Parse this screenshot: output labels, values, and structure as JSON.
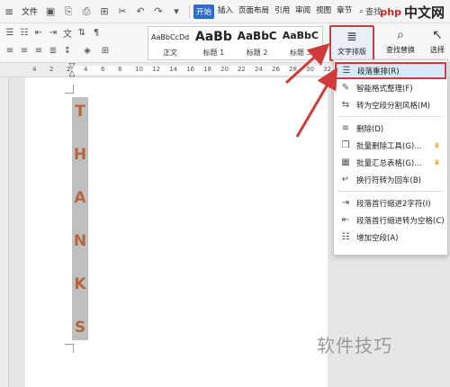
{
  "topbar": {
    "file_menu": "文件",
    "tabs": [
      "开始",
      "插入",
      "页面布局",
      "引用",
      "审阅",
      "视图",
      "章节"
    ],
    "active_tab_index": 0,
    "search_label": "查找",
    "brand_logo": "php",
    "brand_text": "中文网"
  },
  "ribbon": {
    "styles": [
      {
        "sample": "AaBbCcDd",
        "name": "正文"
      },
      {
        "sample": "AaBb",
        "name": "标题 1"
      },
      {
        "sample": "AaBbC",
        "name": "标题 2"
      },
      {
        "sample": "AaBbC",
        "name": "标题 3"
      }
    ],
    "text_layout_label": "文字排版",
    "find_replace_label": "查找替换",
    "select_label": "选择"
  },
  "ruler": {
    "numbers": [
      "4",
      "2",
      "2",
      "4",
      "6",
      "8",
      "10",
      "12",
      "14",
      "16",
      "18",
      "20",
      "22",
      "24",
      "26",
      "28",
      "30",
      "32"
    ]
  },
  "document": {
    "letters": [
      "T",
      "H",
      "A",
      "N",
      "K",
      "S"
    ],
    "letter_color": "#b5663c",
    "column_bg": "#bfbfbf"
  },
  "dropdown": {
    "items": [
      {
        "label": "段落重排(R)",
        "icon": "paragraph-rearrange-icon",
        "glyph": "☰",
        "highlighted": true,
        "premium": false
      },
      {
        "label": "智能格式整理(F)",
        "icon": "smart-format-icon",
        "glyph": "✎",
        "highlighted": false,
        "premium": false
      },
      {
        "label": "转为空段分割风格(M)",
        "icon": "split-style-icon",
        "glyph": "⇆",
        "highlighted": false,
        "premium": false
      },
      {
        "label": "删除(D)",
        "icon": "delete-icon",
        "glyph": "≡",
        "highlighted": false,
        "premium": false,
        "divider_before": true
      },
      {
        "label": "批量删除工具(G)...",
        "icon": "batch-delete-icon",
        "glyph": "❐",
        "highlighted": false,
        "premium": true
      },
      {
        "label": "批量汇总表格(G)...",
        "icon": "batch-table-icon",
        "glyph": "▦",
        "highlighted": false,
        "premium": true
      },
      {
        "label": "换行符转为回车(B)",
        "icon": "linebreak-icon",
        "glyph": "↵",
        "highlighted": false,
        "premium": false
      },
      {
        "label": "段落首行缩进2字符(I)",
        "icon": "indent-icon",
        "glyph": "⇥",
        "highlighted": false,
        "premium": false,
        "divider_before": true
      },
      {
        "label": "段落首行缩进转为空格(C)",
        "icon": "indent-space-icon",
        "glyph": "⇤",
        "highlighted": false,
        "premium": false
      },
      {
        "label": "增加空段(A)",
        "icon": "add-paragraph-icon",
        "glyph": "☷",
        "highlighted": false,
        "premium": false
      }
    ],
    "crown_glyph": "♛"
  },
  "watermark": {
    "text": "软件技巧"
  },
  "colors": {
    "accent_blue": "#2d6cc9",
    "highlight_red": "#d13a3a"
  }
}
